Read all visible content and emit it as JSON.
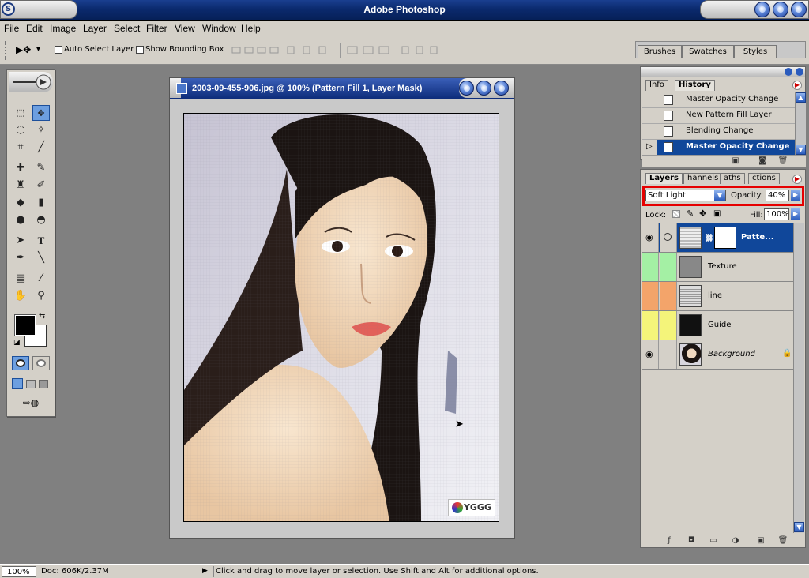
{
  "app": {
    "title": "Adobe Photoshop",
    "logo_glyph": "S"
  },
  "menu": [
    "File",
    "Edit",
    "Image",
    "Layer",
    "Select",
    "Filter",
    "View",
    "Window",
    "Help"
  ],
  "options_bar": {
    "tool_arrow": "▶✥",
    "dropdown_caret": "▾",
    "auto_select_label": "Auto Select Layer",
    "auto_select_checked": false,
    "bounding_box_label": "Show Bounding Box",
    "bounding_box_checked": false,
    "palette_well_tabs": [
      "Brushes",
      "Swatches",
      "Styles"
    ]
  },
  "document": {
    "title": "2003-09-455-906.jpg @ 100% (Pattern Fill 1, Layer Mask)",
    "watermark": "YGGG"
  },
  "history_panel": {
    "tabs": [
      "Info",
      "History"
    ],
    "active_tab": "History",
    "items": [
      {
        "label": "Master Opacity Change",
        "selected": false
      },
      {
        "label": "New Pattern Fill Layer",
        "selected": false
      },
      {
        "label": "Blending Change",
        "selected": false
      },
      {
        "label": "Master Opacity Change",
        "selected": true
      }
    ]
  },
  "layers_panel": {
    "tabs": [
      "Layers",
      "Channels",
      "Paths",
      "Actions"
    ],
    "tab_display": [
      "Layers",
      "hannels",
      "aths",
      "ctions"
    ],
    "active_tab": "Layers",
    "blend_mode": "Soft Light",
    "opacity_label": "Opacity:",
    "opacity_value": "40%",
    "lock_label": "Lock:",
    "fill_label": "Fill:",
    "fill_value": "100%",
    "highlight_color": "#e60000",
    "layers": [
      {
        "name": "Patte...",
        "visible": true,
        "selected": true,
        "color": "#10479a"
      },
      {
        "name": "Texture",
        "visible": false,
        "selected": false,
        "color": "#a4f0a4"
      },
      {
        "name": "line",
        "visible": false,
        "selected": false,
        "color": "#f3a46a"
      },
      {
        "name": "Guide",
        "visible": false,
        "selected": false,
        "color": "#f4f47a"
      },
      {
        "name": "Background",
        "visible": true,
        "selected": false,
        "color": "#d4d0c8",
        "locked": true
      }
    ]
  },
  "status_bar": {
    "zoom": "100%",
    "doc_info": "Doc: 606K/2.37M",
    "arrow": "▶",
    "hint": "Click and drag to move layer or selection.  Use Shift and Alt for additional options."
  }
}
